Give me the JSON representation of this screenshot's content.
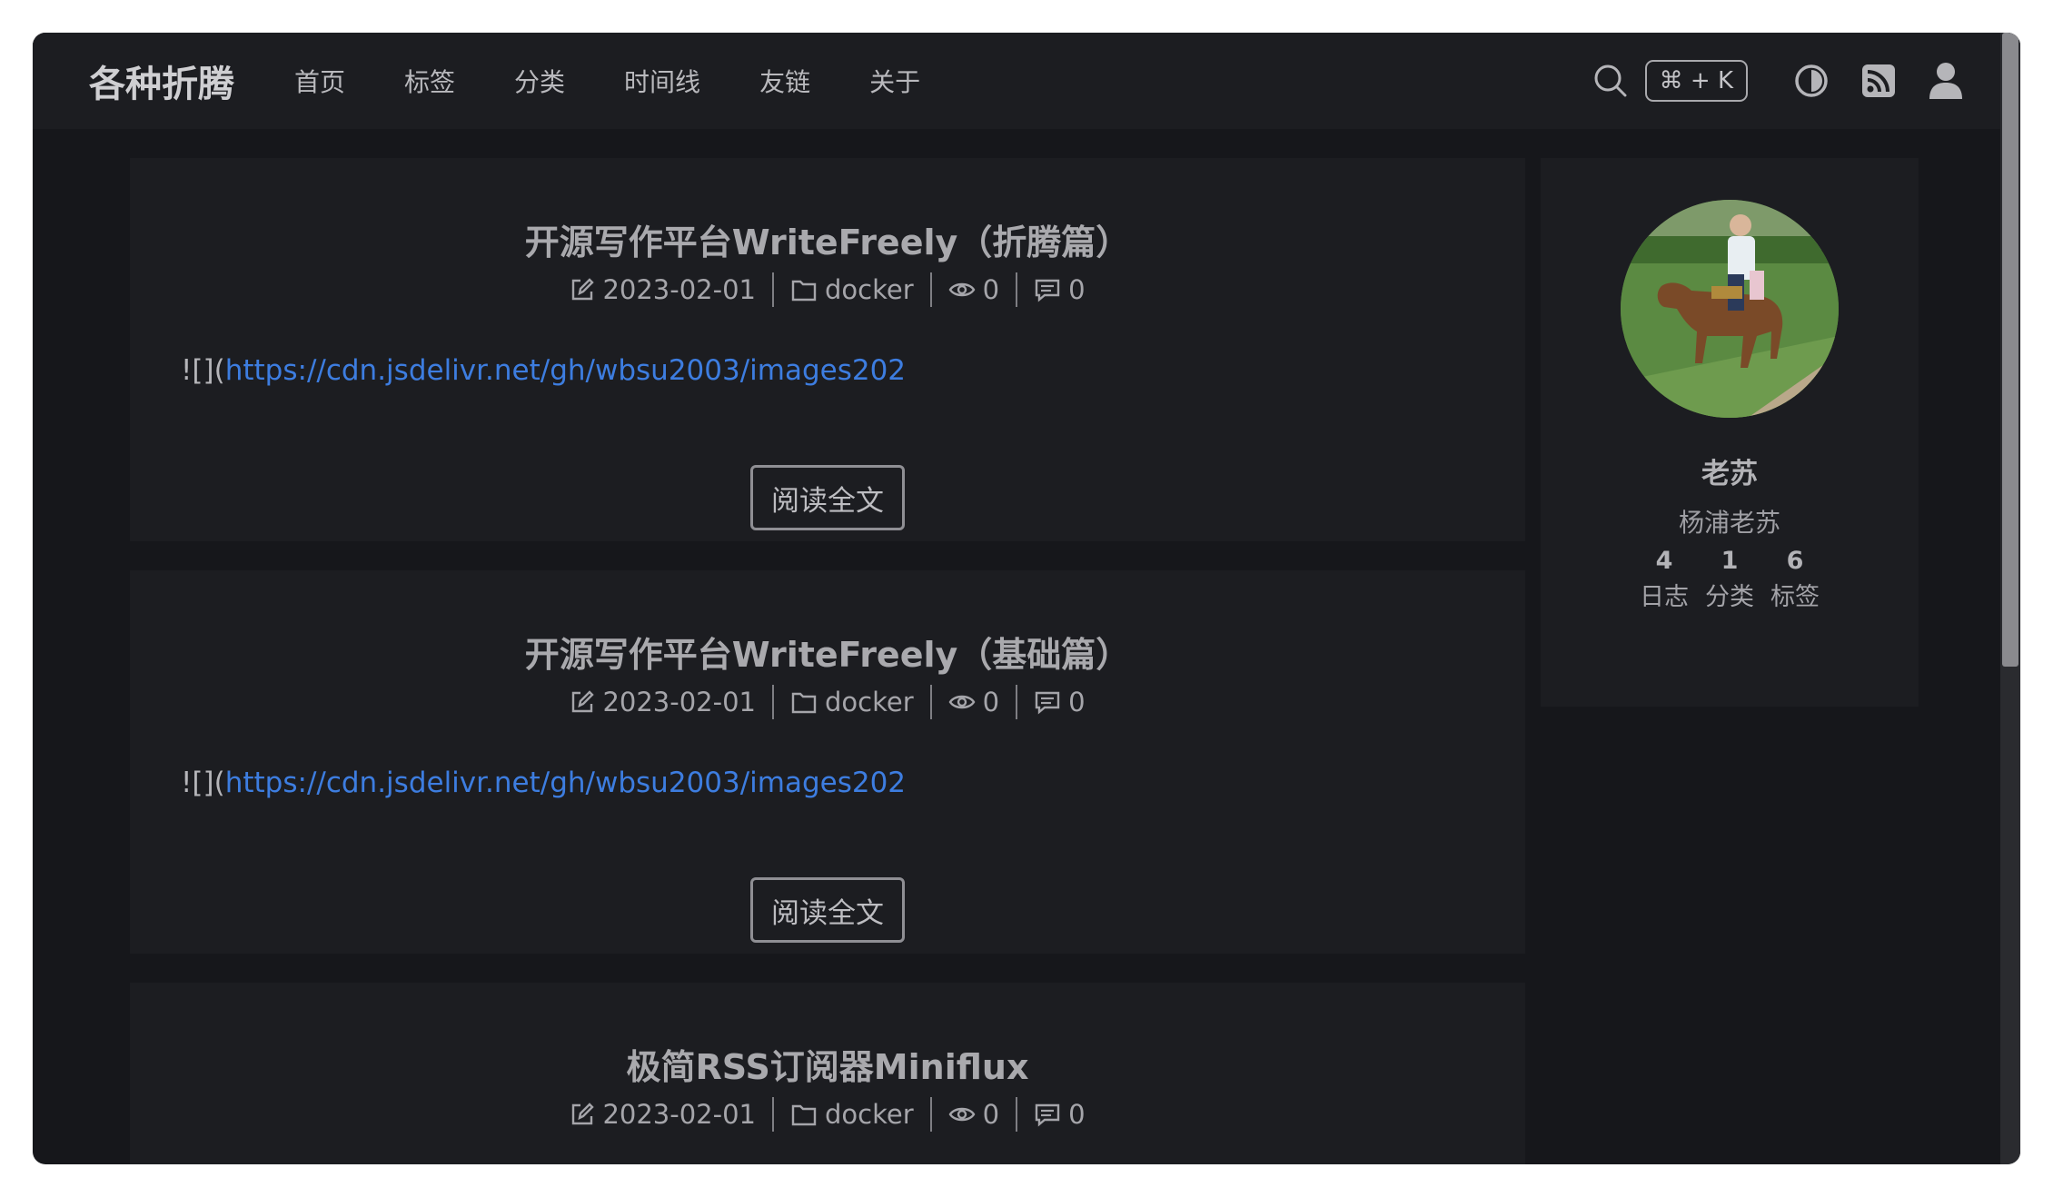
{
  "site": {
    "brand": "各种折腾"
  },
  "nav": [
    "首页",
    "标签",
    "分类",
    "时间线",
    "友链",
    "关于"
  ],
  "search": {
    "shortcut": "⌘ + K"
  },
  "icons": [
    "search-icon",
    "contrast-icon",
    "rss-icon",
    "user-icon",
    "edit-icon",
    "folder-icon",
    "eye-icon",
    "comment-icon"
  ],
  "colors": {
    "background": "#16171b",
    "card": "#1c1d21",
    "link": "#3d7de0"
  },
  "posts": [
    {
      "title": "开源写作平台WriteFreely（折腾篇）",
      "date": "2023-02-01",
      "category": "docker",
      "views": "0",
      "comments": "0",
      "excerpt_prefix": "![](",
      "excerpt_link": "https://cdn.jsdelivr.net/gh/wbsu2003/images202",
      "read_more": "阅读全文"
    },
    {
      "title": "开源写作平台WriteFreely（基础篇）",
      "date": "2023-02-01",
      "category": "docker",
      "views": "0",
      "comments": "0",
      "excerpt_prefix": "![](",
      "excerpt_link": "https://cdn.jsdelivr.net/gh/wbsu2003/images202",
      "read_more": "阅读全文"
    },
    {
      "title": "极简RSS订阅器Miniflux",
      "date": "2023-02-01",
      "category": "docker",
      "views": "0",
      "comments": "0"
    }
  ],
  "profile": {
    "name": "老苏",
    "subtitle": "杨浦老苏",
    "stats": [
      {
        "count": "4",
        "label": "日志"
      },
      {
        "count": "1",
        "label": "分类"
      },
      {
        "count": "6",
        "label": "标签"
      }
    ]
  }
}
